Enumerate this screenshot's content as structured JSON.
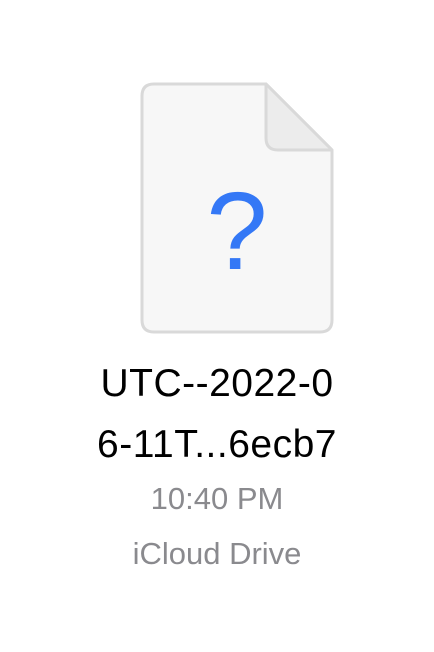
{
  "file": {
    "icon": "unknown-file-icon",
    "glyph": "?",
    "name_line1": "UTC--2022-0",
    "name_line2": "6-11T...6ecb7",
    "time": "10:40 PM",
    "location": "iCloud Drive"
  },
  "colors": {
    "question_mark": "#3478f6",
    "page_fill": "#f7f7f7",
    "page_border": "#d9d9d9",
    "secondary_text": "#8a8a8e"
  }
}
